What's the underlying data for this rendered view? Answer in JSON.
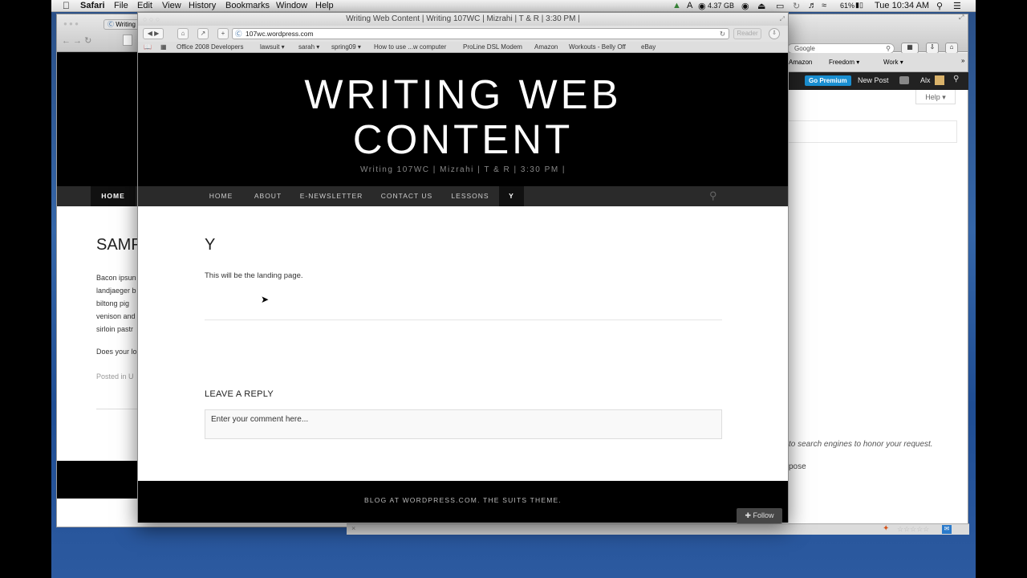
{
  "menubar": {
    "app": "Safari",
    "menus": [
      "File",
      "Edit",
      "View",
      "History",
      "Bookmarks",
      "Window",
      "Help"
    ],
    "status_memory": "4.37 GB",
    "battery": "61%",
    "clock": "Tue 10:34 AM"
  },
  "back_window": {
    "tab_label": "Writing",
    "search_placeholder": "Google",
    "bookmarks": [
      "Amazon",
      "Freedom ▾",
      "Work ▾"
    ],
    "admin_go_premium": "Go Premium",
    "admin_new_post": "New Post",
    "admin_user": "Alx",
    "help_button": "Help",
    "nav_home": "HOME",
    "post_title_partial": "SAMP",
    "body_lines": [
      "Bacon ipsun",
      "landjaeger b",
      "biltong pig",
      "venison and",
      "sirloin pastr"
    ],
    "question_partial": "Does your lo",
    "posted_in_partial": "Posted in U",
    "privacy_text_partial": "to search engines to honor your request.",
    "privacy_text2_partial": "pose"
  },
  "front_window": {
    "title": "Writing Web Content | Writing 107WC | Mizrahi | T & R | 3:30 PM |",
    "url": "107wc.wordpress.com",
    "reader_button": "Reader",
    "bookmarks": [
      "Office 2008 Developers",
      "lawsuit ▾",
      "sarah ▾",
      "spring09 ▾",
      "How to use ...w computer",
      "ProLine DSL Modem",
      "Amazon",
      "Workouts - Belly Off",
      "eBay"
    ],
    "site": {
      "title_line1": "WRITING WEB",
      "title_line2": "CONTENT",
      "tagline": "Writing 107WC | Mizrahi | T & R | 3:30 PM |",
      "nav": [
        "HOME",
        "ABOUT",
        "E-NEWSLETTER",
        "CONTACT US",
        "LESSONS",
        "Y"
      ]
    },
    "page": {
      "heading": "Y",
      "body": "This will be the landing page.",
      "reply_heading": "LEAVE A REPLY",
      "comment_placeholder": "Enter your comment here..."
    },
    "footer": "BLOG AT WORDPRESS.COM. THE SUITS THEME.",
    "follow_button": "Follow"
  }
}
